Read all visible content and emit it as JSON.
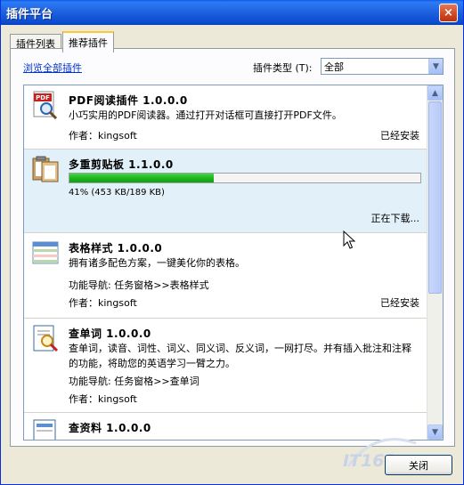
{
  "window": {
    "title": "插件平台",
    "close_glyph": "×"
  },
  "tabs": [
    {
      "label": "插件列表",
      "active": false
    },
    {
      "label": "推荐插件",
      "active": true
    }
  ],
  "toolbar": {
    "browse_all_label": "浏览全部插件",
    "type_label": "插件类型 (T):",
    "type_value": "全部"
  },
  "plugins": [
    {
      "name": "PDF阅读插件 1.0.0.0",
      "description": "小巧实用的PDF阅读器。通过打开对话框可直接打开PDF文件。",
      "author": "作者：kingsoft",
      "status": "已经安装",
      "icon": "pdf-reader-icon"
    },
    {
      "name": "多重剪贴板 1.1.0.0",
      "progress": 0.41,
      "progress_text": "41% (453 KB/189 KB)",
      "status": "正在下载...",
      "icon": "clipboard-icon",
      "selected": true
    },
    {
      "name": "表格样式 1.0.0.0",
      "description": "拥有诸多配色方案，一键美化你的表格。",
      "nav": "功能导航: 任务窗格>>表格样式",
      "author": "作者：kingsoft",
      "status": "已经安装",
      "icon": "table-style-icon"
    },
    {
      "name": "查单词 1.0.0.0",
      "description": "查单词，读音、词性、词义、同义词、反义词，一网打尽。并有插入批注和注释的功能，将助您的英语学习一臂之力。",
      "nav": "功能导航: 任务窗格>>查单词",
      "author": "作者：kingsoft",
      "icon": "dictionary-icon"
    },
    {
      "name": "查资料 1.0.0.0",
      "icon": "research-icon"
    }
  ],
  "footer": {
    "close_label": "关闭"
  },
  "watermark": {
    "text": "IT168.com"
  },
  "colors": {
    "title_bar": "#0A5AE8",
    "progress": "#19B319",
    "selected_row": "#E2F0F9",
    "link": "#0033CC"
  }
}
